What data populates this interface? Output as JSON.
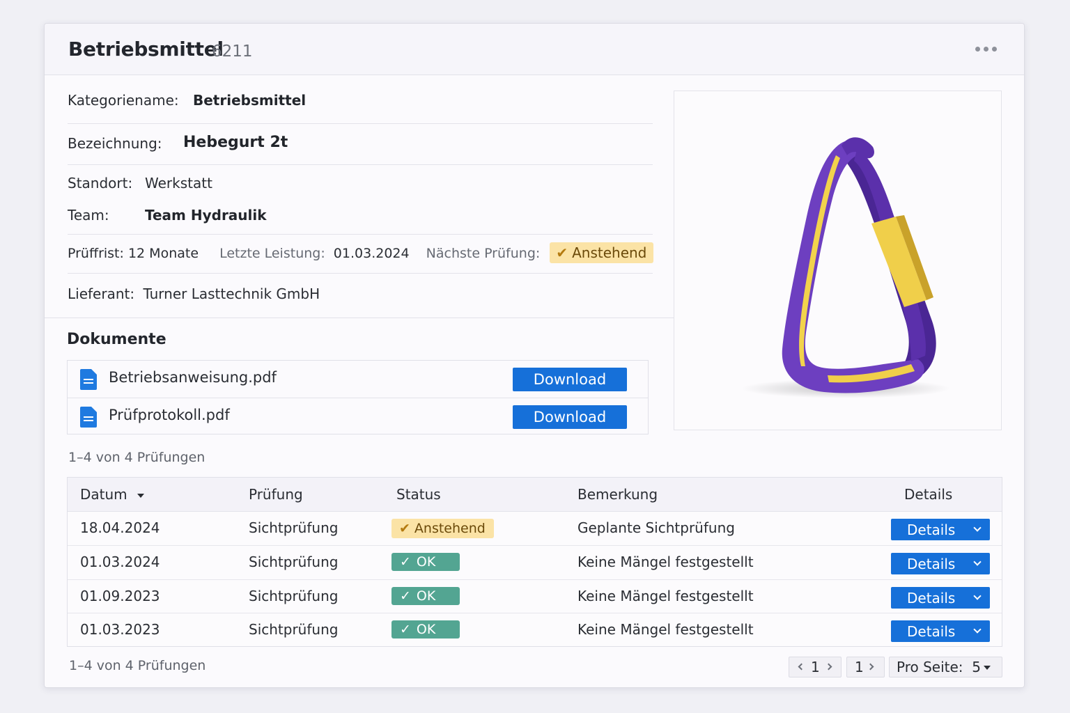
{
  "header": {
    "title": "Betriebsmittel",
    "id": "6211"
  },
  "details": {
    "kategorie_label": "Kategoriename:",
    "kategorie_value": "Betriebsmittel",
    "bezeichnung_label": "Bezeichnung:",
    "bezeichnung_value": "Hebegurt 2t",
    "standort_label": "Standort:",
    "standort_value": "Werkstatt",
    "team_label": "Team:",
    "team_value": "Team Hydraulik",
    "prueffrist_label": "Prüffrist:",
    "prueffrist_value": "12 Monate",
    "letzte_label": "Letzte Leistung:",
    "letzte_value": "01.03.2024",
    "naechste_label": "Nächste Prüfung:",
    "naechste_value": "Anstehend",
    "lieferant_label": "Lieferant:",
    "lieferant_value": "Turner Lasttechnik GmbH"
  },
  "image": {
    "alt": "Hebegurt 2t",
    "colors": {
      "sling": "#6d3fc0",
      "sling_dark": "#4a2694",
      "stripe": "#f2d34c",
      "sleeve": "#f0cf4a"
    }
  },
  "documents": {
    "title": "Dokumente",
    "items": [
      {
        "name": "Betriebsanweisung.pdf",
        "button": "Download"
      },
      {
        "name": "Prüfprotokoll.pdf",
        "button": "Download"
      }
    ]
  },
  "table": {
    "count_text": "1–4 von 4 Prüfungen",
    "columns": [
      "Datum",
      "Prüfung",
      "Status",
      "Bemerkung",
      "Details"
    ],
    "rows": [
      {
        "datum": "18.04.2024",
        "pruefung": "Sichtprüfung",
        "status": "Anstehend",
        "status_type": "pending",
        "bemerkung": "Geplante Sichtprüfung",
        "details": "Details"
      },
      {
        "datum": "01.03.2024",
        "pruefung": "Sichtprüfung",
        "status": "OK",
        "status_type": "ok",
        "bemerkung": "Keine Mängel festgestellt",
        "details": "Details"
      },
      {
        "datum": "01.09.2023",
        "pruefung": "Sichtprüfung",
        "status": "OK",
        "status_type": "ok",
        "bemerkung": "Keine Mängel festgestellt",
        "details": "Details"
      },
      {
        "datum": "01.03.2023",
        "pruefung": "Sichtprüfung",
        "status": "OK",
        "status_type": "ok",
        "bemerkung": "Keine Mängel festgestellt",
        "details": "Details"
      }
    ]
  },
  "pagination": {
    "count_text": "1–4 von 4 Prüfungen",
    "page_prev": "1",
    "page_next": "1",
    "per_page_label": "Pro Seite:",
    "per_page_value": "5"
  },
  "colors": {
    "primary": "#1670d9",
    "ok": "#53a592",
    "pending_bg": "#fbe3a6"
  }
}
